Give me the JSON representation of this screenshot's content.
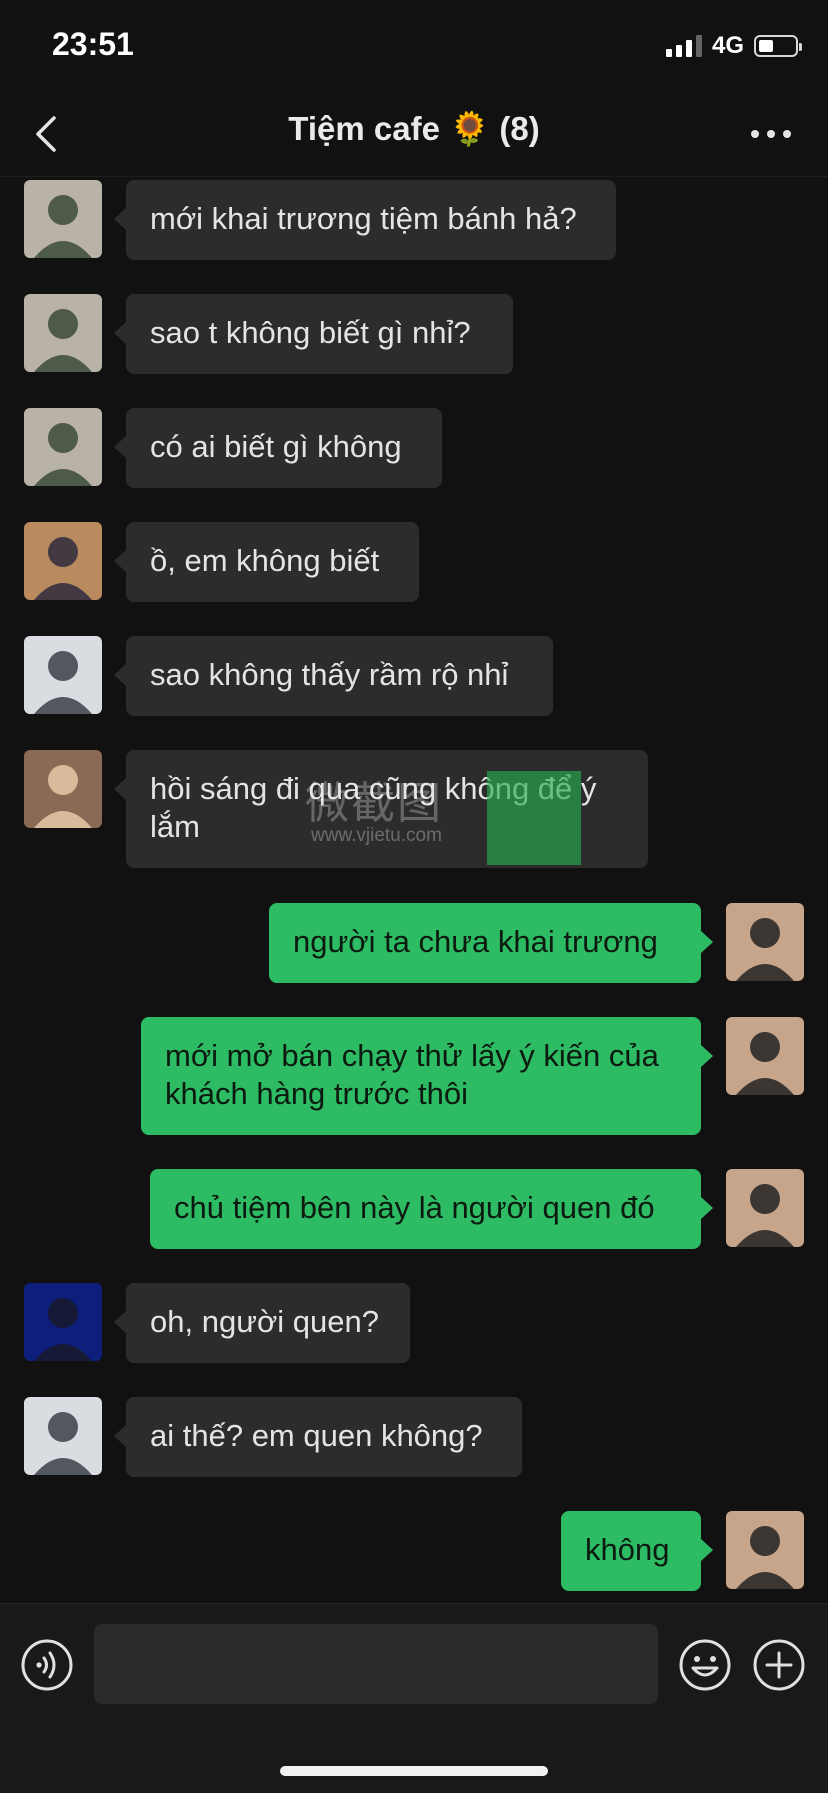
{
  "status": {
    "time": "23:51",
    "network": "4G",
    "battery_level": 0.4
  },
  "header": {
    "back_icon": "chevron-left-icon",
    "title": "Tiệm cafe 🌻 (8)",
    "more_icon": "more-horizontal-icon"
  },
  "colors": {
    "background": "#111111",
    "incoming_bubble": "#2c2c2c",
    "outgoing_bubble": "#2dbb63"
  },
  "watermark": {
    "text": "微截图",
    "url": "www.vjietu.com"
  },
  "messages": [
    {
      "side": "left",
      "sender": "user-a",
      "text": "mới khai trương tiệm bánh hả?"
    },
    {
      "side": "left",
      "sender": "user-a",
      "text": "sao t không biết gì nhỉ?"
    },
    {
      "side": "left",
      "sender": "user-a",
      "text": "có ai biết gì không"
    },
    {
      "side": "left",
      "sender": "user-b",
      "text": "ồ, em không biết"
    },
    {
      "side": "left",
      "sender": "user-c",
      "text": "sao không thấy rầm rộ nhỉ"
    },
    {
      "side": "left",
      "sender": "user-d",
      "text": "hồi sáng đi qua cũng không để ý lắm"
    },
    {
      "side": "right",
      "sender": "me",
      "text": "người ta chưa khai trương"
    },
    {
      "side": "right",
      "sender": "me",
      "text": "mới mở bán chạy thử lấy ý kiến của khách hàng trước thôi"
    },
    {
      "side": "right",
      "sender": "me",
      "text": "chủ tiệm bên này là người quen đó"
    },
    {
      "side": "left",
      "sender": "user-e",
      "text": "oh, người quen?"
    },
    {
      "side": "left",
      "sender": "user-c",
      "text": "ai thế? em quen không?"
    },
    {
      "side": "right",
      "sender": "me",
      "text": "không"
    }
  ],
  "input": {
    "placeholder": "",
    "voice_icon": "voice-icon",
    "emoji_icon": "emoji-icon",
    "add_icon": "plus-circle-icon"
  }
}
